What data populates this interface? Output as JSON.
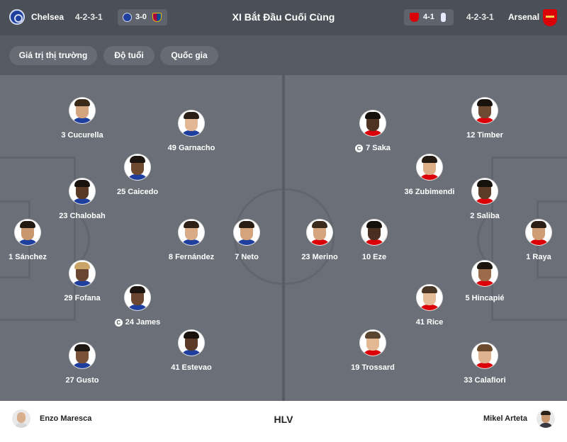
{
  "header": {
    "home": {
      "name": "Chelsea",
      "formation": "4-2-3-1"
    },
    "away": {
      "name": "Arsenal",
      "formation": "4-2-3-1"
    },
    "title": "XI Bắt Đầu Cuối Cùng",
    "home_recent": {
      "score": "3-0",
      "opponent_icon": "barcelona-crest-icon"
    },
    "away_recent": {
      "score": "4-1",
      "opponent_icon": "tottenham-crest-icon"
    }
  },
  "tabs": [
    "Giá trị thị trường",
    "Độ tuổi",
    "Quốc gia"
  ],
  "captain_marker": "C",
  "home_players": [
    {
      "number": "3",
      "name": "Cucurella",
      "label": "3 Cucurella",
      "captain": false,
      "skin": "#d3a57e",
      "hair": "#3a2a1a"
    },
    {
      "number": "49",
      "name": "Garnacho",
      "label": "49 Garnacho",
      "captain": false,
      "skin": "#e2b894",
      "hair": "#2b2018"
    },
    {
      "number": "25",
      "name": "Caicedo",
      "label": "25 Caicedo",
      "captain": false,
      "skin": "#6e4a30",
      "hair": "#1d1510"
    },
    {
      "number": "23",
      "name": "Chalobah",
      "label": "23 Chalobah",
      "captain": false,
      "skin": "#5a3a24",
      "hair": "#1a120c"
    },
    {
      "number": "1",
      "name": "Sánchez",
      "label": "1 Sánchez",
      "captain": false,
      "skin": "#c9976e",
      "hair": "#231a12"
    },
    {
      "number": "8",
      "name": "Fernández",
      "label": "8 Fernández",
      "captain": false,
      "skin": "#d9ab86",
      "hair": "#2e2218"
    },
    {
      "number": "7",
      "name": "Neto",
      "label": "7 Neto",
      "captain": false,
      "skin": "#d6a47c",
      "hair": "#2a1d14"
    },
    {
      "number": "29",
      "name": "Fofana",
      "label": "29 Fofana",
      "captain": false,
      "skin": "#6a4530",
      "hair": "#c9a56a"
    },
    {
      "number": "24",
      "name": "James",
      "label": "24 James",
      "captain": true,
      "skin": "#6b4631",
      "hair": "#1c140e"
    },
    {
      "number": "41",
      "name": "Estevao",
      "label": "41 Estevao",
      "captain": false,
      "skin": "#5b3b27",
      "hair": "#1a120c"
    },
    {
      "number": "27",
      "name": "Gusto",
      "label": "27 Gusto",
      "captain": false,
      "skin": "#7a5238",
      "hair": "#1e1610"
    }
  ],
  "away_players": [
    {
      "number": "12",
      "name": "Timber",
      "label": "12 Timber",
      "captain": false,
      "skin": "#6e4a32",
      "hair": "#1a130d"
    },
    {
      "number": "7",
      "name": "Saka",
      "label": "7 Saka",
      "captain": true,
      "skin": "#4e3222",
      "hair": "#15100b"
    },
    {
      "number": "36",
      "name": "Zubimendi",
      "label": "36 Zubimendi",
      "captain": false,
      "skin": "#dcae88",
      "hair": "#231a12"
    },
    {
      "number": "2",
      "name": "Saliba",
      "label": "2 Saliba",
      "captain": false,
      "skin": "#5c3b27",
      "hair": "#17110b"
    },
    {
      "number": "23",
      "name": "Merino",
      "label": "23 Merino",
      "captain": false,
      "skin": "#d5a57f",
      "hair": "#3b2b1c"
    },
    {
      "number": "10",
      "name": "Eze",
      "label": "10 Eze",
      "captain": false,
      "skin": "#4a2f20",
      "hair": "#14100b"
    },
    {
      "number": "1",
      "name": "Raya",
      "label": "1 Raya",
      "captain": false,
      "skin": "#cf9e77",
      "hair": "#2a1e15"
    },
    {
      "number": "5",
      "name": "Hincapié",
      "label": "5 Hincapié",
      "captain": false,
      "skin": "#9c6b49",
      "hair": "#1b140e"
    },
    {
      "number": "41",
      "name": "Rice",
      "label": "41 Rice",
      "captain": false,
      "skin": "#e4bc98",
      "hair": "#4a3624"
    },
    {
      "number": "19",
      "name": "Trossard",
      "label": "19 Trossard",
      "captain": false,
      "skin": "#e3b994",
      "hair": "#5a4530"
    },
    {
      "number": "33",
      "name": "Calafiori",
      "label": "33 Calafiori",
      "captain": false,
      "skin": "#e0b390",
      "hair": "#6b4b2c"
    }
  ],
  "coaches": {
    "label": "HLV",
    "home": "Enzo Maresca",
    "away": "Mikel Arteta"
  }
}
